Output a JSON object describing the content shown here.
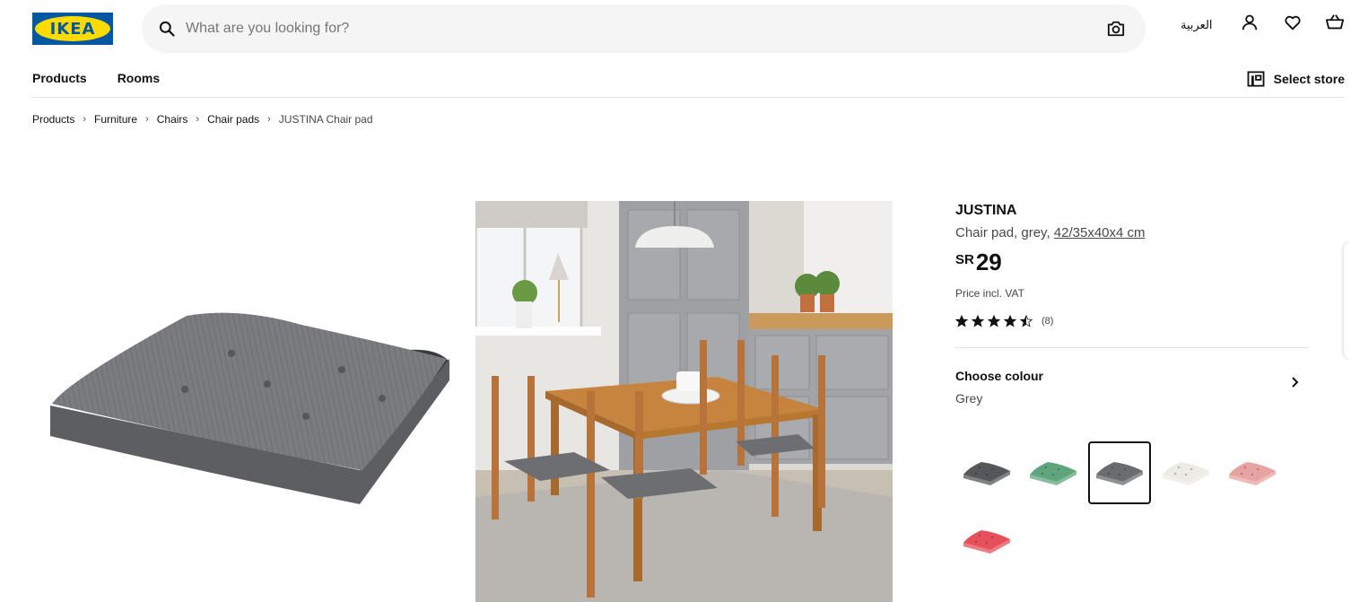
{
  "header": {
    "logo_text": "IKEA",
    "search_placeholder": "What are you looking for?",
    "language": "العربية",
    "icons": [
      "search-icon",
      "camera-icon",
      "user-icon",
      "heart-icon",
      "cart-icon"
    ]
  },
  "nav": {
    "items": [
      {
        "label": "Products"
      },
      {
        "label": "Rooms"
      }
    ],
    "store_label": "Select store"
  },
  "breadcrumb": [
    "Products",
    "Furniture",
    "Chairs",
    "Chair pads",
    "JUSTINA Chair pad"
  ],
  "product": {
    "name": "JUSTINA",
    "description": "Chair pad, grey,",
    "measurement": "42/35x40x4 cm",
    "currency": "SR",
    "price": "29",
    "vat_note": "Price incl. VAT",
    "rating_value": 4.5,
    "rating_max": 5,
    "review_count": "(8)"
  },
  "colour": {
    "label": "Choose colour",
    "selected": "Grey",
    "swatches": [
      {
        "name": "dark-grey",
        "color": "#55575a"
      },
      {
        "name": "green",
        "color": "#5fa57c"
      },
      {
        "name": "grey",
        "color": "#6b6c6f",
        "selected": true
      },
      {
        "name": "white",
        "color": "#ecebe4"
      },
      {
        "name": "pink",
        "color": "#e7a3a1"
      },
      {
        "name": "red",
        "color": "#e5505a"
      }
    ]
  },
  "colors": {
    "brand_blue": "#0058a3",
    "brand_yellow": "#ffdb00",
    "search_bg": "#f5f5f5"
  }
}
